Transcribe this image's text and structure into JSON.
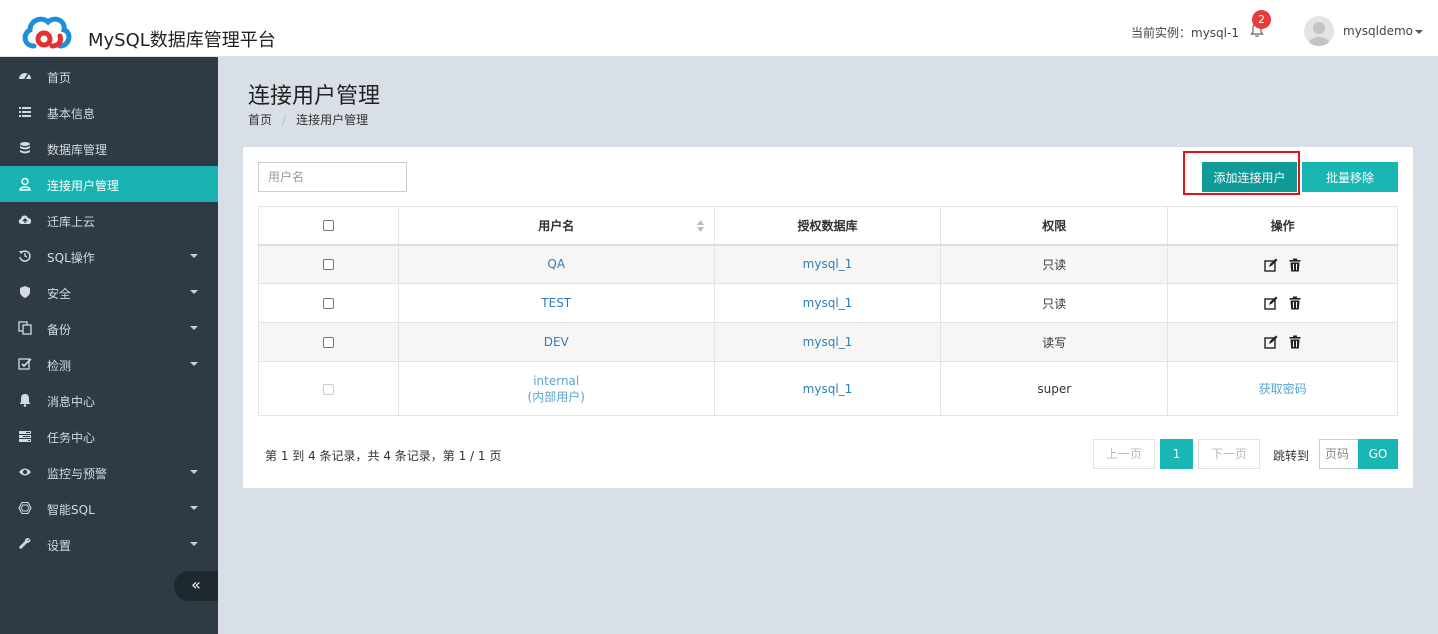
{
  "header": {
    "app_title": "MySQL数据库管理平台",
    "instance_text": "当前实例：mysql-1",
    "notification_count": "2",
    "username": "mysqldemo"
  },
  "sidebar": {
    "items": [
      {
        "label": "首页",
        "icon": "dashboard-icon",
        "active": false,
        "caret": false
      },
      {
        "label": "基本信息",
        "icon": "list-icon",
        "active": false,
        "caret": false
      },
      {
        "label": "数据库管理",
        "icon": "database-icon",
        "active": false,
        "caret": false
      },
      {
        "label": "连接用户管理",
        "icon": "user-icon",
        "active": true,
        "caret": false
      },
      {
        "label": "迁库上云",
        "icon": "cloud-upload-icon",
        "active": false,
        "caret": false
      },
      {
        "label": "SQL操作",
        "icon": "history-icon",
        "active": false,
        "caret": true
      },
      {
        "label": "安全",
        "icon": "shield-icon",
        "active": false,
        "caret": true
      },
      {
        "label": "备份",
        "icon": "copy-icon",
        "active": false,
        "caret": true
      },
      {
        "label": "检测",
        "icon": "check-square-icon",
        "active": false,
        "caret": true
      },
      {
        "label": "消息中心",
        "icon": "bell-icon",
        "active": false,
        "caret": false
      },
      {
        "label": "任务中心",
        "icon": "tasks-icon",
        "active": false,
        "caret": false
      },
      {
        "label": "监控与预警",
        "icon": "eye-icon",
        "active": false,
        "caret": true
      },
      {
        "label": "智能SQL",
        "icon": "hexagon-icon",
        "active": false,
        "caret": true
      },
      {
        "label": "设置",
        "icon": "wrench-icon",
        "active": false,
        "caret": true
      }
    ],
    "collapse_label": "«"
  },
  "page": {
    "title": "连接用户管理",
    "breadcrumb": [
      "首页",
      "连接用户管理"
    ]
  },
  "toolbar": {
    "search_placeholder": "用户名",
    "add_label": "添加连接用户",
    "remove_label": "批量移除"
  },
  "table": {
    "headers": [
      "",
      "用户名",
      "授权数据库",
      "权限",
      "操作"
    ],
    "rows": [
      {
        "username": "QA",
        "database": "mysql_1",
        "permission": "只读",
        "action": "icons"
      },
      {
        "username": "TEST",
        "database": "mysql_1",
        "permission": "只读",
        "action": "icons"
      },
      {
        "username": "DEV",
        "database": "mysql_1",
        "permission": "读写",
        "action": "icons"
      },
      {
        "username": "internal",
        "username_sub": "(内部用户)",
        "database": "mysql_1",
        "permission": "super",
        "action_text": "获取密码"
      }
    ]
  },
  "pagination": {
    "records_text": "第 1 到 4 条记录，共 4 条记录，第 1 / 1 页",
    "prev_label": "上一页",
    "current_page": "1",
    "next_label": "下一页",
    "jump_label": "跳转到",
    "page_placeholder": "页码",
    "go_label": "GO"
  },
  "colors": {
    "accent": "#18b7b4",
    "sidebar_bg": "#2e3b45",
    "highlight": "#e0121a"
  }
}
